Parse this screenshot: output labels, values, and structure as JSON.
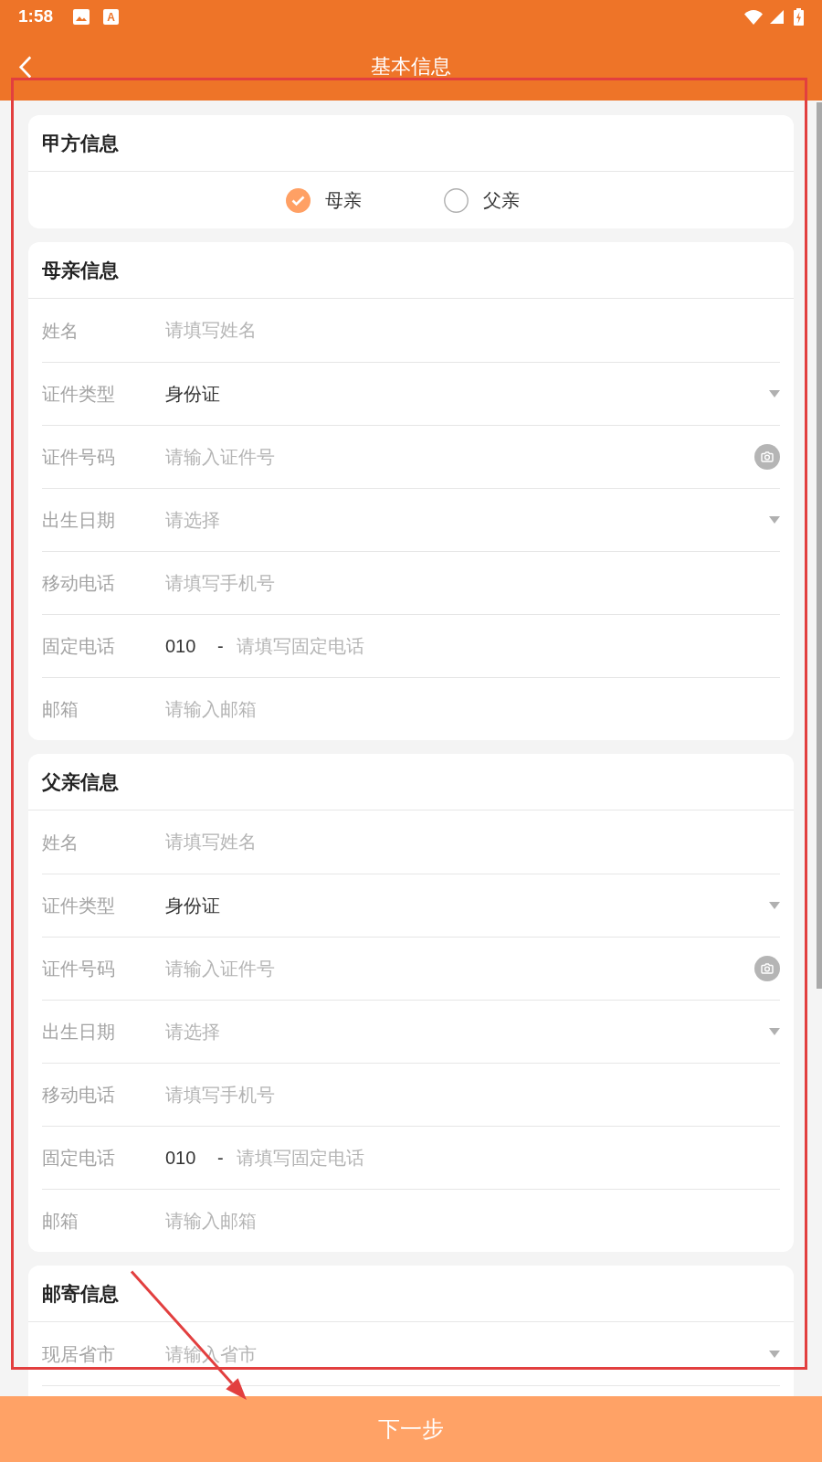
{
  "status_bar": {
    "time": "1:58",
    "notification_letter": "A"
  },
  "header": {
    "title": "基本信息"
  },
  "party_section": {
    "title": "甲方信息",
    "options": [
      {
        "label": "母亲",
        "selected": true
      },
      {
        "label": "父亲",
        "selected": false
      }
    ]
  },
  "sections": [
    {
      "title": "母亲信息",
      "continues_below": false,
      "fields": [
        {
          "kind": "text",
          "label": "姓名",
          "placeholder": "请填写姓名"
        },
        {
          "kind": "select",
          "label": "证件类型",
          "value": "身份证"
        },
        {
          "kind": "scan",
          "label": "证件号码",
          "placeholder": "请输入证件号"
        },
        {
          "kind": "select",
          "label": "出生日期",
          "placeholder": "请选择"
        },
        {
          "kind": "text",
          "label": "移动电话",
          "placeholder": "请填写手机号"
        },
        {
          "kind": "phone",
          "label": "固定电话",
          "area_code": "010",
          "separator": "-",
          "placeholder": "请填写固定电话"
        },
        {
          "kind": "text",
          "label": "邮箱",
          "placeholder": "请输入邮箱"
        }
      ]
    },
    {
      "title": "父亲信息",
      "continues_below": false,
      "fields": [
        {
          "kind": "text",
          "label": "姓名",
          "placeholder": "请填写姓名"
        },
        {
          "kind": "select",
          "label": "证件类型",
          "value": "身份证"
        },
        {
          "kind": "scan",
          "label": "证件号码",
          "placeholder": "请输入证件号"
        },
        {
          "kind": "select",
          "label": "出生日期",
          "placeholder": "请选择"
        },
        {
          "kind": "text",
          "label": "移动电话",
          "placeholder": "请填写手机号"
        },
        {
          "kind": "phone",
          "label": "固定电话",
          "area_code": "010",
          "separator": "-",
          "placeholder": "请填写固定电话"
        },
        {
          "kind": "text",
          "label": "邮箱",
          "placeholder": "请输入邮箱"
        }
      ]
    },
    {
      "title": "邮寄信息",
      "continues_below": true,
      "fields": [
        {
          "kind": "select",
          "label": "现居省市",
          "placeholder": "请输入省市"
        }
      ]
    }
  ],
  "next_button": {
    "label": "下一步"
  },
  "annotations": {
    "highlight_box": true,
    "arrow": true
  }
}
